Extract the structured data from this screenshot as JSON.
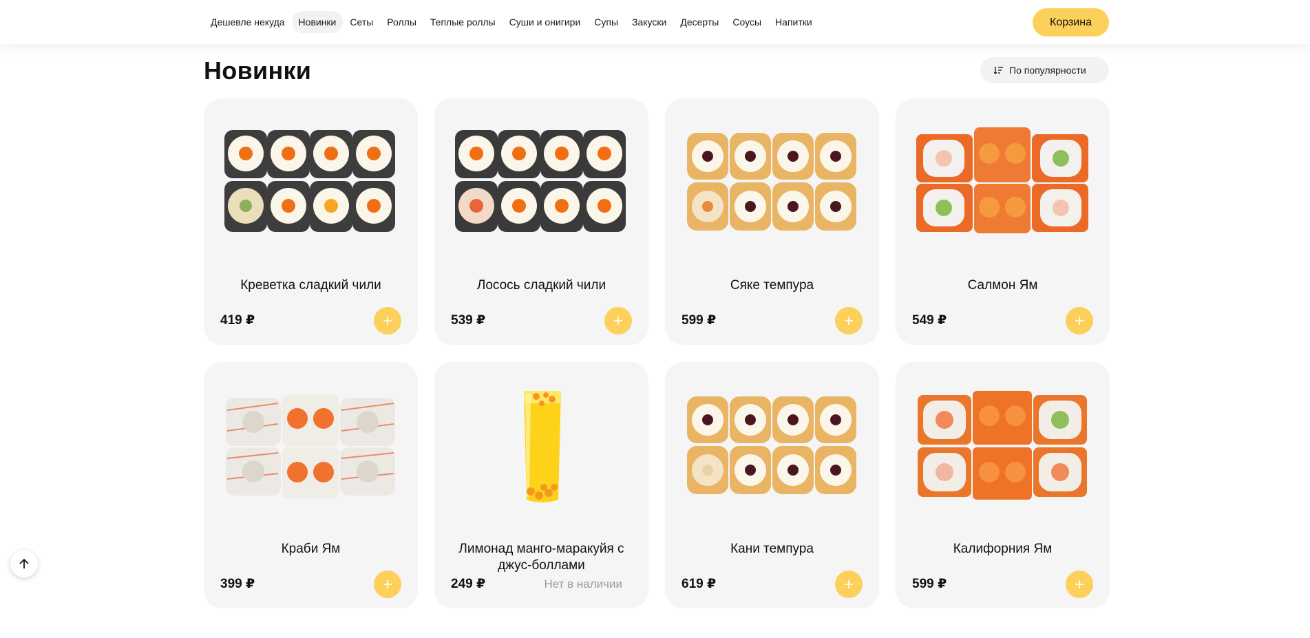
{
  "nav": {
    "items": [
      {
        "label": "Дешевле некуда",
        "active": false
      },
      {
        "label": "Новинки",
        "active": true
      },
      {
        "label": "Сеты",
        "active": false
      },
      {
        "label": "Роллы",
        "active": false
      },
      {
        "label": "Теплые роллы",
        "active": false
      },
      {
        "label": "Суши и онигири",
        "active": false
      },
      {
        "label": "Супы",
        "active": false
      },
      {
        "label": "Закуски",
        "active": false
      },
      {
        "label": "Десерты",
        "active": false
      },
      {
        "label": "Соусы",
        "active": false
      },
      {
        "label": "Напитки",
        "active": false
      }
    ],
    "cart_label": "Корзина"
  },
  "page": {
    "title": "Новинки",
    "sort_label": "По популярности"
  },
  "colors": {
    "accent": "#fcd05a",
    "card_bg": "#f5f5f5",
    "muted_text": "#9b9b9b"
  },
  "products": [
    {
      "name": "Креветка сладкий чили",
      "price": "419 ₽",
      "image": "sushi-roll-set-image",
      "in_stock": true
    },
    {
      "name": "Лосось сладкий чили",
      "price": "539 ₽",
      "image": "sushi-roll-set-image",
      "in_stock": true
    },
    {
      "name": "Сяке темпура",
      "price": "599 ₽",
      "image": "tempura-roll-set-image",
      "in_stock": true
    },
    {
      "name": "Салмон Ям",
      "price": "549 ₽",
      "image": "salmon-roll-set-image",
      "in_stock": true
    },
    {
      "name": "Краби Ям",
      "price": "399 ₽",
      "image": "crab-roll-set-image",
      "in_stock": true
    },
    {
      "name": "Лимонад манго-маракуйя с джус-боллами",
      "price": "249 ₽",
      "image": "lemonade-glass-image",
      "in_stock": false,
      "status": "Нет в наличии"
    },
    {
      "name": "Кани темпура",
      "price": "619 ₽",
      "image": "tempura-roll-set-image",
      "in_stock": true
    },
    {
      "name": "Калифорния Ям",
      "price": "599 ₽",
      "image": "california-roll-set-image",
      "in_stock": true
    }
  ],
  "icons": {
    "sort": "sort-icon",
    "add": "plus-icon",
    "scroll_top": "arrow-up-icon"
  }
}
